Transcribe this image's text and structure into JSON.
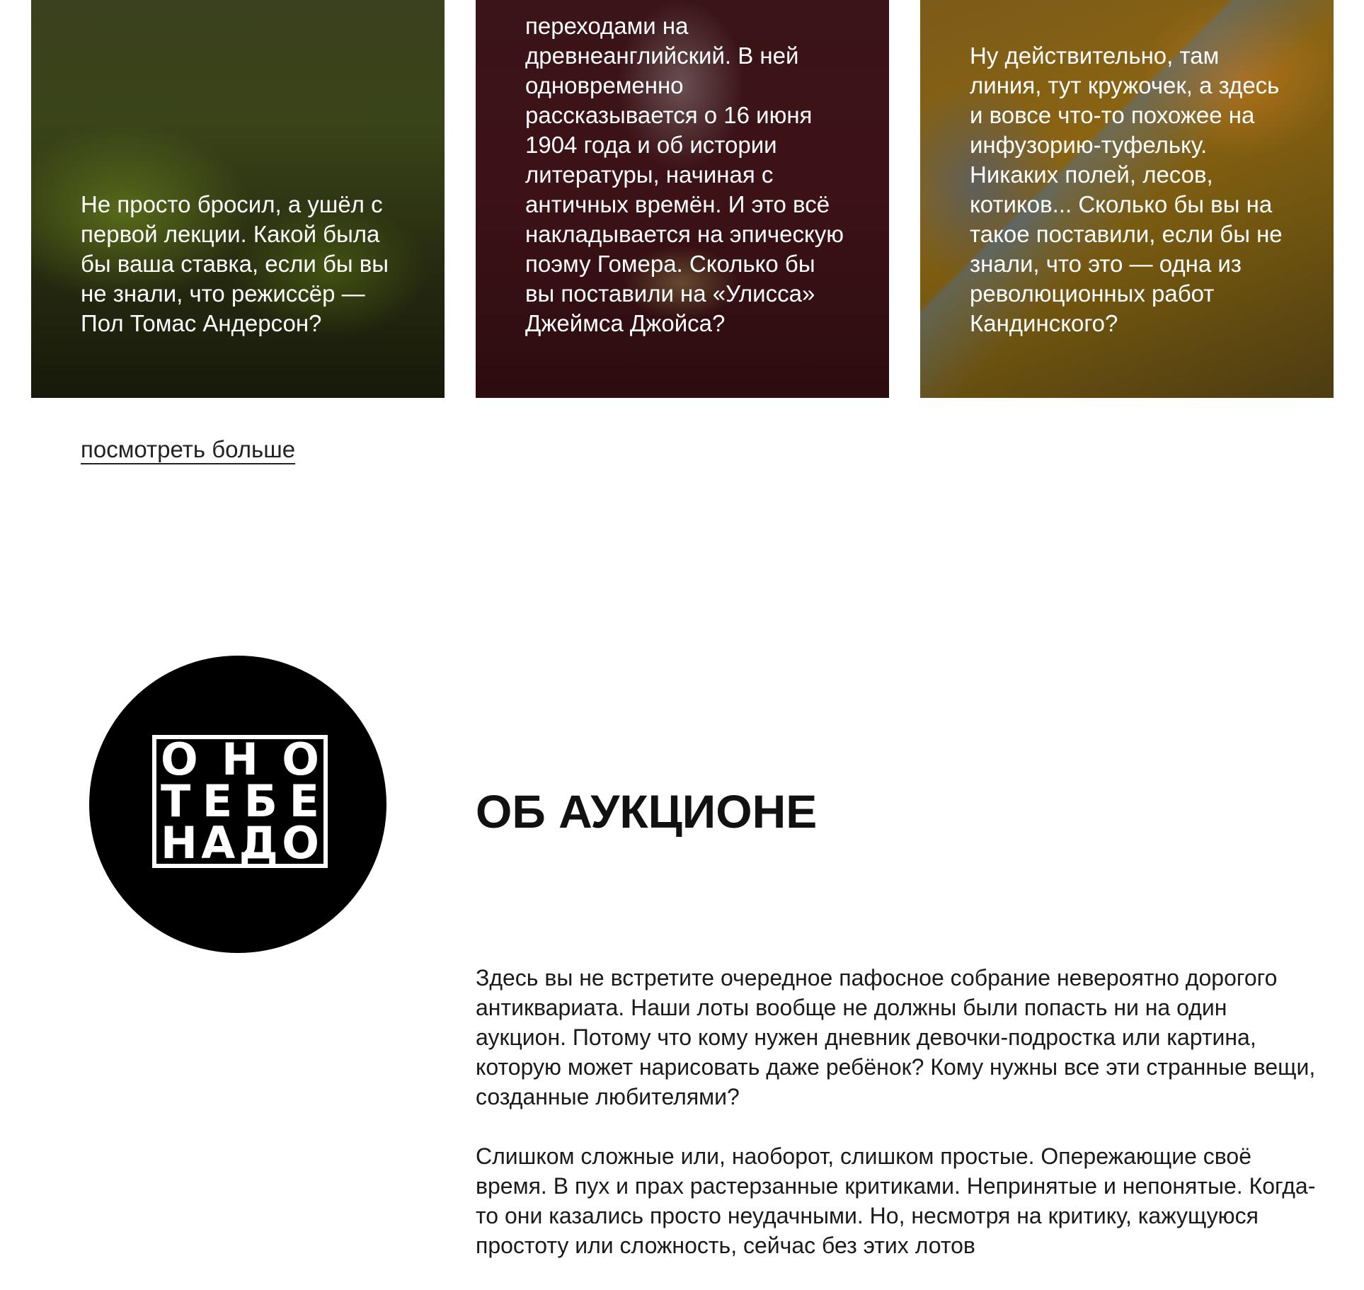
{
  "cards": [
    {
      "text": "Не просто бросил, а ушёл с первой лекции. Какой была бы ваша ставка, если бы вы не знали, что режиссёр — Пол Томас Андерсон?"
    },
    {
      "text": "переходами на древнеанглийский. В ней одновременно рассказывается о 16 июня 1904 года и об истории литературы, начиная с античных времён. И это всё накладывается на эпическую поэму Гомера. Сколько бы вы поставили на «Улисса» Джеймса Джойса?"
    },
    {
      "text": "Ну действительно, там линия, тут кружочек, а здесь и вовсе что-то похожее на инфузорию-туфельку. Никаких полей, лесов, котиков... Сколько бы вы на такое поставили, если бы не знали, что это — одна из революционных работ Кандинского?"
    }
  ],
  "more_link": "посмотреть больше",
  "logo": {
    "line1": "ОНО",
    "line2": "ТЕБЕ",
    "line3": "НАДО"
  },
  "about": {
    "title": "ОБ АУКЦИОНЕ",
    "paragraph1": "Здесь вы не встретите очередное пафосное собрание невероятно дорогого антиквариата. Наши лоты вообще не должны были попасть ни на один аукцион. Потому что кому нужен дневник девочки-подростка или картина, которую может нарисовать даже ребёнок? Кому нужны все эти странные вещи, созданные любителями?",
    "paragraph2": "Слишком сложные или, наоборот, слишком простые. Опережающие своё время. В пух и прах растерзанные критиками. Непринятые и непонятые. Когда-то они казались просто неудачными. Но, несмотря на критику, кажущуюся простоту или сложность, сейчас без этих лотов"
  }
}
